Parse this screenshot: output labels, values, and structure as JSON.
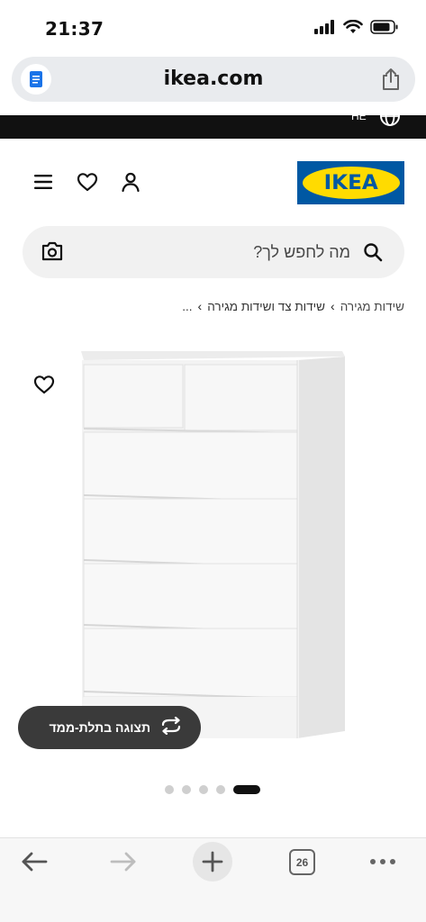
{
  "status_bar": {
    "time": "21:37"
  },
  "browser": {
    "url": "ikea.com",
    "tabs_count": "26"
  },
  "top_strip": {
    "language": "HE"
  },
  "header": {
    "logo_text": "IKEA",
    "brand_blue": "#0058a3",
    "brand_yellow": "#ffdb00"
  },
  "search": {
    "placeholder": "מה לחפש לך?"
  },
  "breadcrumb": {
    "ellipsis": "...",
    "items": [
      "שידות צד ושידות מגירה",
      "שידות מגירה"
    ]
  },
  "product": {
    "view_3d_label": "תצוגה בתלת-ממד"
  },
  "carousel": {
    "dot_count": 5,
    "active_index": 4
  }
}
